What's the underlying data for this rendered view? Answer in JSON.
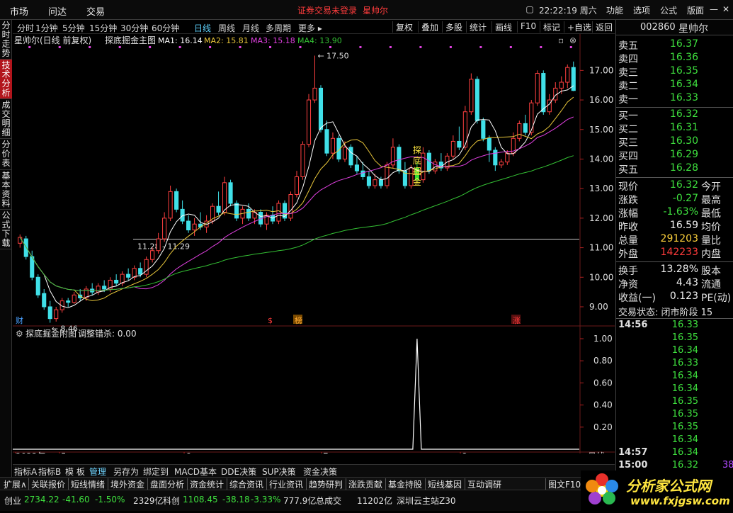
{
  "topbar": {
    "menus": [
      "市场",
      "问达",
      "交易"
    ],
    "notice": "证券交易未登录",
    "stock_name": "星帅尔",
    "clock": "22:22:19 周六",
    "right_menus": [
      "功能",
      "选项",
      "公式",
      "版面"
    ],
    "win_buttons": [
      "▢",
      "—",
      "▭",
      "✕"
    ]
  },
  "left_tabs": [
    {
      "label": "分时走势",
      "active": false
    },
    {
      "label": "技术分析",
      "active": true
    },
    {
      "label": "成交明细",
      "active": false
    },
    {
      "label": "分价表",
      "active": false
    },
    {
      "label": "基本资料",
      "active": false
    },
    {
      "label": "公式下载",
      "active": false
    }
  ],
  "period_bar": {
    "items": [
      "分时",
      "1分钟",
      "5分钟",
      "15分钟",
      "30分钟",
      "60分钟",
      "日线",
      "周线",
      "月线",
      "多周期",
      "更多 ▸"
    ],
    "selected": "日线",
    "tools": [
      "复权",
      "叠加",
      "多股",
      "统计",
      "画线",
      "F10",
      "标记",
      "+自选",
      "返回"
    ]
  },
  "main_chart": {
    "header_title": "星帅尔(日线 前复权)",
    "indicator_name": "探底掘金主图",
    "ma": [
      {
        "label": "MA1: 16.14",
        "color": "#ffffff"
      },
      {
        "label": "MA2: 15.81",
        "color": "#e8c63a"
      },
      {
        "label": "MA3: 15.18",
        "color": "#e040e0"
      },
      {
        "label": "MA4: 13.90",
        "color": "#34c034"
      }
    ],
    "high_label": "17.50",
    "low_label": "8.46",
    "range_label": "11.28 - 11.29",
    "signal_text": [
      "探",
      "底",
      "掘",
      "金"
    ],
    "markers": [
      {
        "text": "财",
        "color": "#4aa0ff"
      },
      {
        "text": "$",
        "color": "#ff3b3b"
      },
      {
        "text": "榜",
        "color": "#ffaa33"
      },
      {
        "text": "涨",
        "color": "#ff3b3b"
      }
    ],
    "y_ticks": [
      "17.00",
      "16.00",
      "15.00",
      "14.00",
      "13.00",
      "12.00",
      "11.00",
      "10.00",
      "9.00"
    ]
  },
  "sub_chart": {
    "title": "探底掘金附图",
    "param": "调整错杀: 0.00",
    "y_ticks": [
      "1.00",
      "0.80",
      "0.60",
      "0.40",
      "0.20"
    ]
  },
  "x_axis": {
    "labels": [
      "2022年",
      "5",
      "6",
      "7",
      "8"
    ],
    "period_label": "日线"
  },
  "quote": {
    "code": "002860",
    "name": "星帅尔",
    "asks": [
      {
        "label": "卖五",
        "price": "16.37"
      },
      {
        "label": "卖四",
        "price": "16.36"
      },
      {
        "label": "卖三",
        "price": "16.35"
      },
      {
        "label": "卖二",
        "price": "16.34"
      },
      {
        "label": "卖一",
        "price": "16.33"
      }
    ],
    "bids": [
      {
        "label": "买一",
        "price": "16.32"
      },
      {
        "label": "买二",
        "price": "16.31"
      },
      {
        "label": "买三",
        "price": "16.30"
      },
      {
        "label": "买四",
        "price": "16.29"
      },
      {
        "label": "买五",
        "price": "16.28"
      }
    ],
    "stats": [
      {
        "label": "现价",
        "value": "16.32",
        "color": "green",
        "label2": "今开"
      },
      {
        "label": "涨跌",
        "value": "-0.27",
        "color": "green",
        "label2": "最高"
      },
      {
        "label": "涨幅",
        "value": "-1.63%",
        "color": "green",
        "label2": "最低"
      },
      {
        "label": "昨收",
        "value": "16.59",
        "color": "white",
        "label2": "均价"
      },
      {
        "label": "总量",
        "value": "291203",
        "color": "yellow",
        "label2": "量比"
      },
      {
        "label": "外盘",
        "value": "142233",
        "color": "red",
        "label2": "内盘"
      }
    ],
    "stats2": [
      {
        "label": "换手",
        "value": "13.28%",
        "label2": "股本"
      },
      {
        "label": "净资",
        "value": "4.43",
        "label2": "流通"
      },
      {
        "label": "收益(一)",
        "value": "0.123",
        "label2": "PE(动)"
      }
    ],
    "trade_state": "交易状态: 闭市阶段 15",
    "ticks": [
      {
        "time": "14:56",
        "price": "16.33"
      },
      {
        "time": "",
        "price": "16.35"
      },
      {
        "time": "",
        "price": "16.34"
      },
      {
        "time": "",
        "price": "16.33"
      },
      {
        "time": "",
        "price": "16.34"
      },
      {
        "time": "",
        "price": "16.34"
      },
      {
        "time": "",
        "price": "16.35"
      },
      {
        "time": "",
        "price": "16.35"
      },
      {
        "time": "",
        "price": "16.35"
      },
      {
        "time": "",
        "price": "16.34"
      },
      {
        "time": "14:57",
        "price": "16.34"
      },
      {
        "time": "15:00",
        "price": "16.32"
      }
    ],
    "tick_extra": "38"
  },
  "bottom_tabs": [
    "指标A",
    "指标B",
    "模 板",
    "管理",
    "另存为",
    "绑定到",
    "MACD基本",
    "DDE决策",
    "SUP决策",
    "资金决策"
  ],
  "bottom_tab_selected": "管理",
  "fn_bar": [
    "扩展∧",
    "关联报价",
    "短线情绪",
    "境外资金",
    "盘面分析",
    "资金统计",
    "综合资讯",
    "行业资讯",
    "趋势研判",
    "涨跌贡献",
    "基金持股",
    "短线基因",
    "互动调研",
    "图文F10"
  ],
  "status_bar": {
    "items": [
      {
        "text": "创业",
        "color": "#e0e0e0"
      },
      {
        "text": "2734.22",
        "color": "#3ee03e"
      },
      {
        "text": "-41.60",
        "color": "#3ee03e"
      },
      {
        "text": "-1.50%",
        "color": "#3ee03e"
      },
      {
        "text": "2329亿",
        "color": "#e0e0e0"
      },
      {
        "text": "科创",
        "color": "#e0e0e0"
      },
      {
        "text": "1108.45",
        "color": "#3ee03e"
      },
      {
        "text": "-38.18",
        "color": "#3ee03e"
      },
      {
        "text": "-3.33%",
        "color": "#3ee03e"
      },
      {
        "text": "777.9亿",
        "color": "#e0e0e0"
      },
      {
        "text": "总成交",
        "color": "#e0e0e0"
      },
      {
        "text": "11202亿",
        "color": "#e0e0e0"
      },
      {
        "text": "深圳云主站Z30",
        "color": "#e0e0e0"
      }
    ]
  },
  "watermark": {
    "title": "分析家公式网",
    "url": "www.fxjgsw.com"
  },
  "chart_data": {
    "type": "candlestick",
    "ylim": [
      8.4,
      17.8
    ],
    "candles": [
      [
        11.15,
        11.45,
        11.0,
        11.35
      ],
      [
        11.3,
        11.4,
        10.6,
        10.7
      ],
      [
        10.7,
        10.9,
        9.9,
        10.0
      ],
      [
        10.0,
        10.1,
        9.3,
        9.4
      ],
      [
        9.45,
        9.6,
        8.9,
        9.0
      ],
      [
        9.0,
        9.2,
        8.46,
        8.6
      ],
      [
        8.6,
        9.0,
        8.5,
        8.9
      ],
      [
        8.9,
        9.3,
        8.8,
        9.2
      ],
      [
        9.2,
        9.3,
        9.0,
        9.15
      ],
      [
        9.15,
        9.5,
        9.1,
        9.4
      ],
      [
        9.4,
        9.6,
        9.2,
        9.3
      ],
      [
        9.3,
        9.7,
        9.2,
        9.6
      ],
      [
        9.6,
        9.8,
        9.4,
        9.5
      ],
      [
        9.5,
        9.8,
        9.4,
        9.7
      ],
      [
        9.7,
        9.9,
        9.5,
        9.6
      ],
      [
        9.6,
        10.0,
        9.5,
        9.9
      ],
      [
        9.9,
        10.1,
        9.7,
        9.8
      ],
      [
        9.8,
        10.2,
        9.7,
        10.1
      ],
      [
        10.1,
        10.3,
        9.9,
        10.0
      ],
      [
        10.0,
        10.4,
        9.9,
        10.3
      ],
      [
        10.3,
        10.5,
        10.0,
        10.1
      ],
      [
        10.1,
        10.7,
        10.0,
        10.6
      ],
      [
        10.6,
        11.0,
        10.5,
        10.9
      ],
      [
        10.9,
        11.5,
        10.8,
        11.3
      ],
      [
        11.3,
        12.2,
        11.2,
        12.0
      ],
      [
        12.0,
        13.1,
        11.9,
        12.9
      ],
      [
        12.9,
        13.0,
        12.2,
        12.3
      ],
      [
        12.3,
        12.6,
        11.8,
        11.9
      ],
      [
        11.9,
        12.1,
        11.5,
        11.6
      ],
      [
        11.6,
        12.0,
        11.4,
        11.8
      ],
      [
        11.8,
        12.2,
        11.6,
        11.7
      ],
      [
        11.7,
        12.1,
        11.5,
        11.9
      ],
      [
        11.9,
        12.5,
        11.8,
        12.4
      ],
      [
        12.4,
        12.9,
        12.1,
        12.2
      ],
      [
        12.2,
        13.4,
        12.1,
        13.2
      ],
      [
        13.2,
        13.3,
        12.4,
        12.5
      ],
      [
        12.5,
        12.6,
        11.9,
        12.0
      ],
      [
        12.0,
        12.4,
        11.8,
        12.3
      ],
      [
        12.3,
        12.5,
        11.9,
        12.0
      ],
      [
        12.0,
        12.3,
        11.8,
        12.2
      ],
      [
        12.2,
        12.3,
        11.7,
        11.8
      ],
      [
        11.8,
        12.2,
        11.6,
        12.1
      ],
      [
        12.1,
        12.4,
        11.8,
        11.9
      ],
      [
        11.9,
        12.6,
        11.8,
        12.5
      ],
      [
        12.5,
        12.6,
        11.9,
        12.0
      ],
      [
        12.0,
        12.9,
        11.9,
        12.8
      ],
      [
        12.8,
        13.6,
        12.7,
        13.4
      ],
      [
        13.4,
        14.6,
        13.3,
        14.5
      ],
      [
        14.5,
        16.2,
        14.4,
        16.0
      ],
      [
        16.0,
        17.5,
        15.9,
        16.4
      ],
      [
        16.4,
        16.5,
        14.9,
        15.0
      ],
      [
        15.0,
        15.3,
        14.1,
        14.2
      ],
      [
        14.2,
        14.9,
        14.0,
        14.7
      ],
      [
        14.7,
        14.8,
        13.9,
        14.0
      ],
      [
        14.0,
        14.6,
        13.9,
        14.4
      ],
      [
        14.4,
        14.5,
        13.7,
        13.8
      ],
      [
        13.8,
        14.1,
        13.5,
        13.6
      ],
      [
        13.6,
        13.9,
        13.3,
        13.4
      ],
      [
        13.4,
        13.6,
        13.0,
        13.1
      ],
      [
        13.1,
        13.5,
        13.0,
        13.3
      ],
      [
        13.3,
        13.4,
        13.0,
        13.1
      ],
      [
        13.1,
        13.9,
        13.0,
        13.8
      ],
      [
        13.8,
        14.7,
        13.7,
        14.4
      ],
      [
        14.4,
        14.5,
        13.5,
        13.6
      ],
      [
        13.6,
        13.9,
        13.0,
        13.1
      ],
      [
        13.1,
        13.8,
        13.0,
        13.7
      ],
      [
        13.7,
        13.9,
        13.2,
        13.3
      ],
      [
        13.3,
        14.4,
        13.2,
        14.2
      ],
      [
        14.2,
        14.3,
        13.5,
        13.6
      ],
      [
        13.6,
        14.0,
        13.5,
        13.9
      ],
      [
        13.9,
        14.2,
        13.6,
        13.7
      ],
      [
        13.7,
        14.2,
        13.6,
        14.1
      ],
      [
        14.1,
        14.8,
        14.0,
        14.6
      ],
      [
        14.6,
        15.1,
        14.3,
        14.4
      ],
      [
        14.4,
        15.8,
        14.3,
        15.6
      ],
      [
        15.6,
        16.9,
        15.5,
        16.7
      ],
      [
        16.7,
        16.8,
        15.2,
        15.3
      ],
      [
        15.3,
        15.4,
        14.6,
        14.7
      ],
      [
        14.7,
        14.8,
        13.9,
        14.3
      ],
      [
        14.3,
        14.4,
        13.6,
        13.8
      ],
      [
        13.8,
        14.0,
        13.7,
        13.9
      ],
      [
        13.9,
        14.3,
        13.8,
        14.2
      ],
      [
        14.2,
        14.9,
        14.1,
        14.7
      ],
      [
        14.7,
        15.3,
        14.6,
        15.2
      ],
      [
        15.2,
        15.5,
        14.8,
        14.9
      ],
      [
        14.9,
        16.0,
        14.8,
        15.9
      ],
      [
        15.9,
        17.0,
        15.8,
        16.9
      ],
      [
        16.9,
        17.0,
        15.5,
        15.6
      ],
      [
        15.6,
        16.2,
        15.5,
        16.0
      ],
      [
        16.0,
        16.6,
        15.9,
        16.4
      ],
      [
        16.4,
        16.8,
        16.2,
        16.6
      ],
      [
        16.6,
        17.2,
        16.4,
        17.1
      ],
      [
        17.1,
        17.3,
        16.3,
        16.32
      ]
    ],
    "signal": {
      "index": 66,
      "value": 1.0
    }
  }
}
